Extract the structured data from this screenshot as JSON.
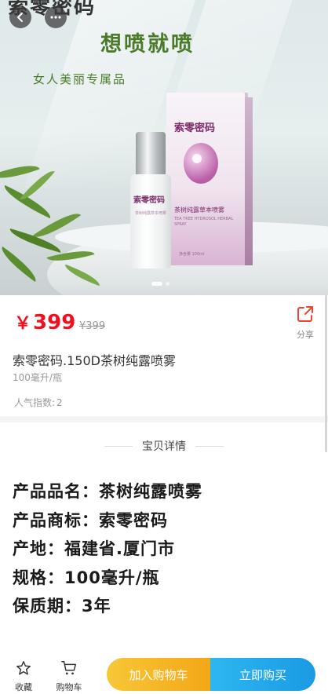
{
  "hero": {
    "brand_cut": "索零密码",
    "slogan": "想喷就喷",
    "sub_slogan": "女人美丽专属品",
    "bottle_logo": "索零密码",
    "bottle_text": "茶树纯露草本喷雾",
    "box_logo": "索零密码",
    "box_name": "茶树纯露草本喷雾",
    "box_en": "TEA TREE HYDROSOL HERBAL SPRAY",
    "box_volume": "净含量 100ml",
    "carousel_count": 2,
    "carousel_active": 1
  },
  "product": {
    "currency": "￥",
    "price": "399",
    "original_price": "¥399",
    "title": "索零密码.150D茶树纯露喷雾",
    "spec": "100毫升/瓶",
    "popularity_label": "人气指数:",
    "popularity_value": "2",
    "share_label": "分享"
  },
  "details": {
    "header": "宝贝详情",
    "rows": [
      "产品品名：茶树纯露喷雾",
      "产品商标：索零密码",
      "产地：福建省.厦门市",
      "规格：100毫升/瓶",
      "保质期：3年"
    ]
  },
  "bottom_bar": {
    "favorite_label": "收藏",
    "cart_label": "购物车",
    "add_to_cart_label": "加入购物车",
    "buy_now_label": "立即购买"
  },
  "colors": {
    "price_red": "#f20f1d",
    "slogan_green": "#4b7a2b",
    "add_cart_orange": "#f3a716",
    "buy_blue": "#1a9ae4"
  }
}
